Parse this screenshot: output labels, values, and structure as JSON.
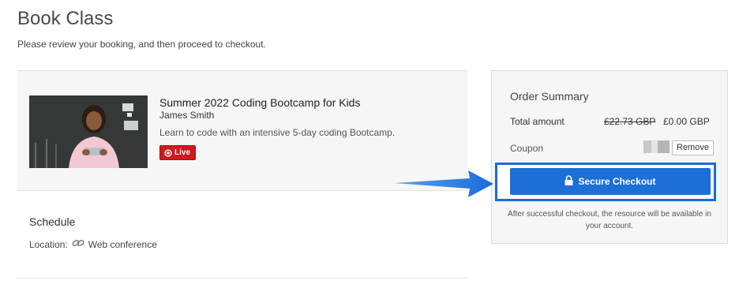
{
  "page": {
    "title": "Book Class",
    "subtitle": "Please review your booking, and then proceed to checkout."
  },
  "booking": {
    "class_title": "Summer 2022 Coding Bootcamp for Kids",
    "instructor": "James Smith",
    "description": "Learn to code with an intensive 5-day coding Bootcamp.",
    "badge": "Live"
  },
  "schedule": {
    "title": "Schedule",
    "location_label": "Location:",
    "location_value": "Web conference"
  },
  "summary": {
    "title": "Order Summary",
    "total_label": "Total amount",
    "original_price": "£22.73 GBP",
    "final_price": "£0.00 GBP",
    "coupon_label": "Coupon",
    "remove_label": "Remove",
    "checkout_label": "Secure Checkout",
    "checkout_note": "After successful checkout, the resource will be available in your account."
  },
  "colors": {
    "primary": "#1c6fd6",
    "live_badge": "#d0191f",
    "arrow": "#1b6bd9"
  },
  "icons": {
    "live": "live-circle-icon",
    "location": "link-icon",
    "checkout": "lock-icon",
    "callout": "arrow-right-icon"
  }
}
